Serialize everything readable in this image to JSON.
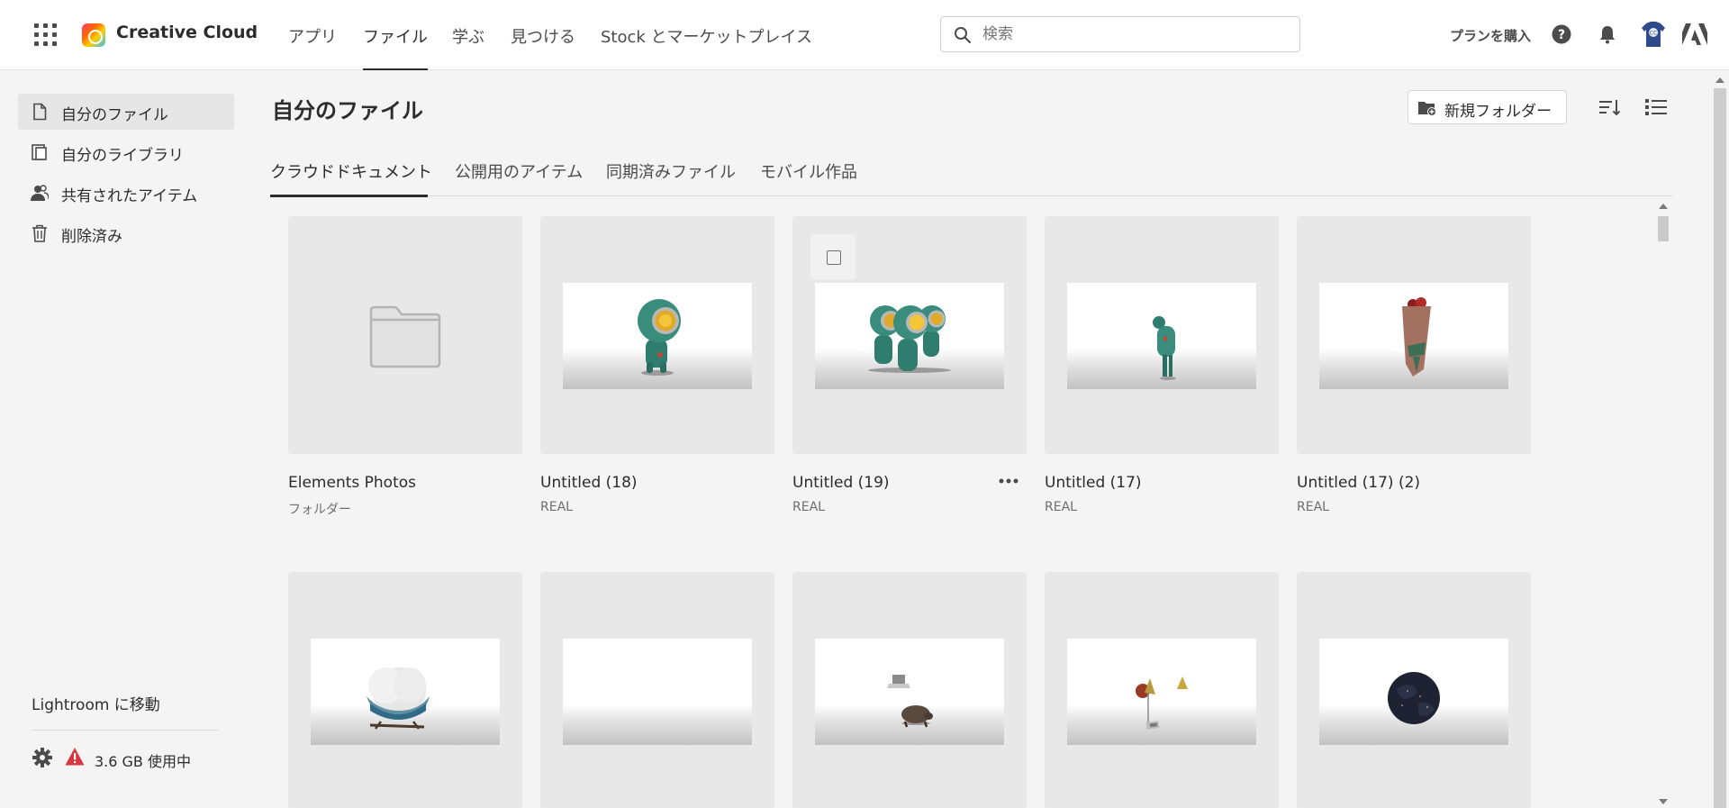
{
  "header": {
    "brand": "Creative Cloud",
    "nav": [
      "アプリ",
      "ファイル",
      "学ぶ",
      "見つける",
      "Stock とマーケットプレイス"
    ],
    "active_nav": "ファイル",
    "search_placeholder": "検索",
    "buy_plan": "プランを購入",
    "icons": [
      "apps-grid-icon",
      "help-icon",
      "bell-icon",
      "avatar",
      "adobe-logo-icon"
    ]
  },
  "sidebar": {
    "items": [
      {
        "label": "自分のファイル",
        "icon": "file-icon",
        "active": true
      },
      {
        "label": "自分のライブラリ",
        "icon": "library-icon",
        "active": false
      },
      {
        "label": "共有されたアイテム",
        "icon": "shared-user-icon",
        "active": false
      },
      {
        "label": "削除済み",
        "icon": "trash-icon",
        "active": false
      }
    ],
    "lightroom_link": "Lightroom に移動",
    "storage": "3.6 GB 使用中"
  },
  "main": {
    "title": "自分のファイル",
    "new_folder": "新規フォルダー",
    "tabs": [
      "クラウドドキュメント",
      "公開用のアイテム",
      "同期済みファイル",
      "モバイル作品"
    ],
    "active_tab": "クラウドドキュメント",
    "cards": [
      {
        "title": "Elements Photos",
        "subtitle": "フォルダー",
        "kind": "folder"
      },
      {
        "title": "Untitled (18)",
        "subtitle": "REAL",
        "kind": "robot"
      },
      {
        "title": "Untitled (19)",
        "subtitle": "REAL",
        "kind": "robots-trio"
      },
      {
        "title": "Untitled (17)",
        "subtitle": "REAL",
        "kind": "figure"
      },
      {
        "title": "Untitled (17) (2)",
        "subtitle": "REAL",
        "kind": "bouquet"
      },
      {
        "title": "",
        "subtitle": "",
        "kind": "cloud-sofa"
      },
      {
        "title": "",
        "subtitle": "",
        "kind": "empty"
      },
      {
        "title": "",
        "subtitle": "",
        "kind": "laptop-armadillo"
      },
      {
        "title": "",
        "subtitle": "",
        "kind": "cones"
      },
      {
        "title": "",
        "subtitle": "",
        "kind": "globe"
      }
    ]
  },
  "colors": {
    "background": "#f4f4f4",
    "card": "#e8e8e8",
    "warning": "#d7373f",
    "text": "#2c2c2c"
  }
}
